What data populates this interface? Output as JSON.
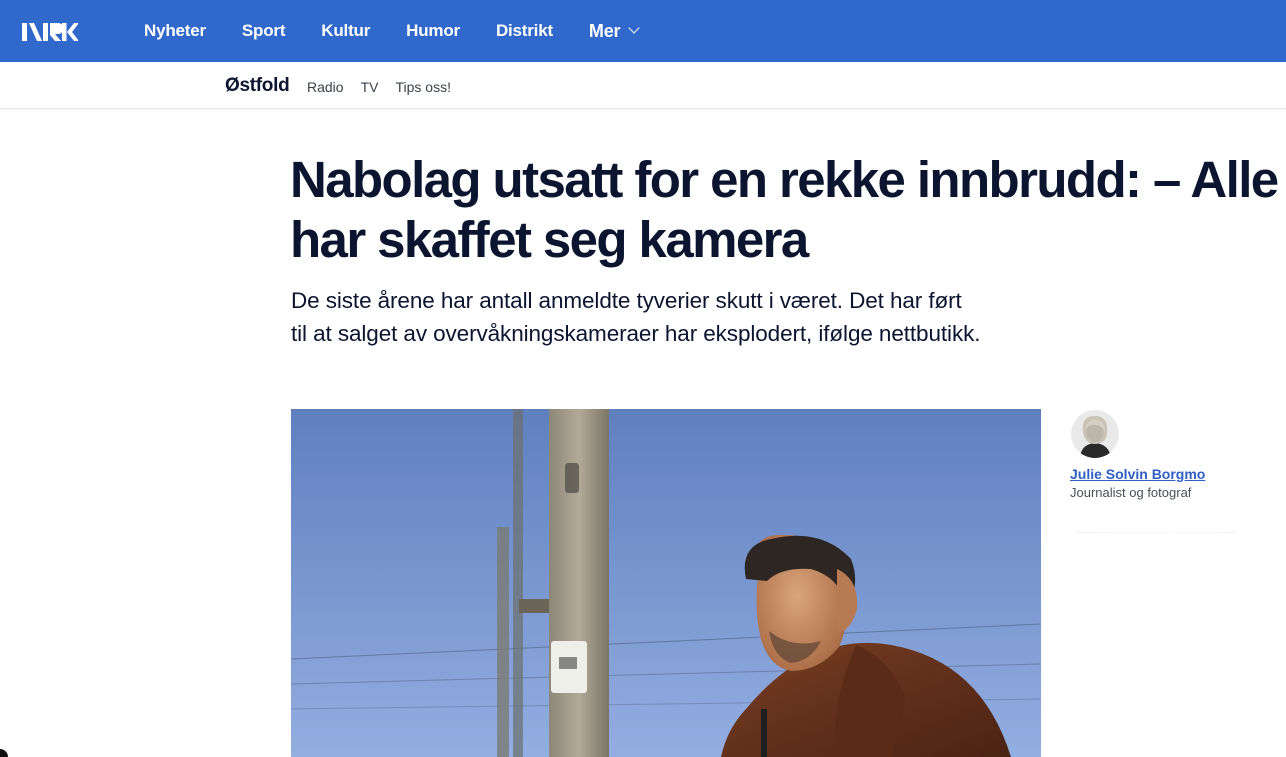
{
  "header": {
    "logo_text": "NRK",
    "nav": [
      {
        "label": "Nyheter"
      },
      {
        "label": "Sport"
      },
      {
        "label": "Kultur"
      },
      {
        "label": "Humor"
      },
      {
        "label": "Distrikt"
      },
      {
        "label": "Mer"
      }
    ],
    "brand_color": "#3068cc"
  },
  "subheader": {
    "region": "Østfold",
    "links": [
      {
        "label": "Radio"
      },
      {
        "label": "TV"
      },
      {
        "label": "Tips oss!"
      }
    ]
  },
  "article": {
    "headline": "Nabolag utsatt for en rekke innbrudd: – Alle har skaffet seg kamera",
    "lead": "De siste årene har antall anmeldte tyverier skutt i været. Det har ført til at salget av overvåkningskameraer har eksplodert, ifølge nettbutikk.",
    "photo_icon": "man-by-utility-pole-photo"
  },
  "byline": {
    "author": "Julie Solvin Borgmo",
    "role": "Journalist og fotograf",
    "avatar_icon": "author-portrait"
  }
}
